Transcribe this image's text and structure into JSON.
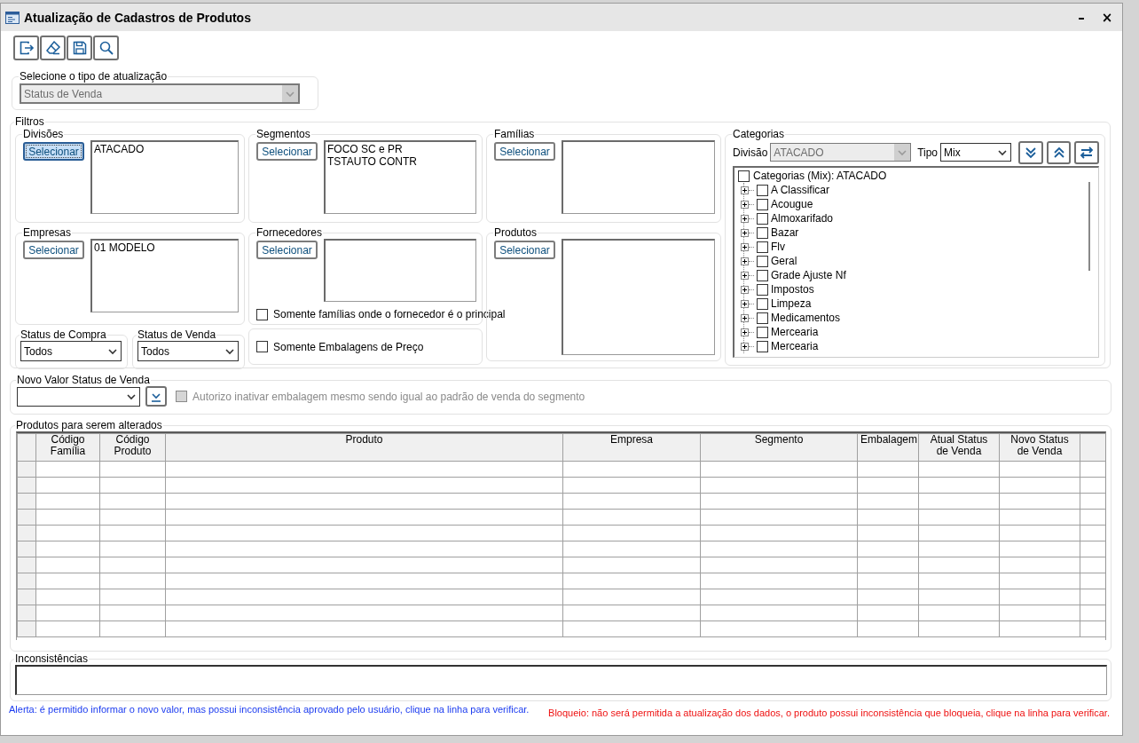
{
  "window": {
    "title": "Atualização de Cadastros de Produtos",
    "minimize": "–",
    "close": "×"
  },
  "toolbar": [
    {
      "kind": "exit"
    },
    {
      "kind": "clear"
    },
    {
      "kind": "save"
    },
    {
      "kind": "search"
    }
  ],
  "update_type": {
    "label": "Selecione o tipo de atualização",
    "value": "Status de Venda",
    "disabled": true
  },
  "filters": {
    "title": "Filtros",
    "divisions": {
      "title": "Divisões",
      "button": "Selecionar",
      "focused": true,
      "items": [
        "ATACADO"
      ]
    },
    "companies": {
      "title": "Empresas",
      "button": "Selecionar",
      "focused": false,
      "items": [
        "01 MODELO"
      ]
    },
    "purchase_status": {
      "title": "Status de Compra",
      "value": "Todos"
    },
    "sale_status": {
      "title": "Status de Venda",
      "value": "Todos"
    },
    "segments": {
      "title": "Segmentos",
      "button": "Selecionar",
      "focused": false,
      "items": [
        "FOCO SC e PR",
        "TSTAUTO CONTR"
      ]
    },
    "suppliers": {
      "title": "Fornecedores",
      "button": "Selecionar",
      "focused": false
    },
    "main_supplier_only": {
      "label": "Somente famílias onde o fornecedor é o principal",
      "checked": false
    },
    "price_packs_only": {
      "label": "Somente Embalagens de Preço",
      "checked": false
    },
    "families": {
      "title": "Famílias",
      "button": "Selecionar",
      "focused": false
    },
    "products": {
      "title": "Produtos",
      "button": "Selecionar",
      "focused": false
    },
    "categories": {
      "title": "Categorias",
      "division_label": "Divisão",
      "division": "ATACADO",
      "division_disabled": true,
      "type_label": "Tipo",
      "type": "Mix",
      "buttons": [
        {
          "kind": "expand_all"
        },
        {
          "kind": "collapse_all"
        },
        {
          "kind": "swap"
        }
      ],
      "tree": {
        "label": "Categorias (Mix): ATACADO",
        "checked": false,
        "children": [
          {
            "label": "A Classificar",
            "checked": false,
            "expanded": false
          },
          {
            "label": "Acougue",
            "checked": false,
            "expanded": false
          },
          {
            "label": "Almoxarifado",
            "checked": false,
            "expanded": false
          },
          {
            "label": "Bazar",
            "checked": false,
            "expanded": false
          },
          {
            "label": "Flv",
            "checked": false,
            "expanded": false
          },
          {
            "label": "Geral",
            "checked": false,
            "expanded": false
          },
          {
            "label": "Grade Ajuste Nf",
            "checked": false,
            "expanded": false
          },
          {
            "label": "Impostos",
            "checked": false,
            "expanded": false
          },
          {
            "label": "Limpeza",
            "checked": false,
            "expanded": false
          },
          {
            "label": "Medicamentos",
            "checked": false,
            "expanded": false
          },
          {
            "label": "Mercearia",
            "checked": false,
            "expanded": false
          },
          {
            "label": "Mercearia",
            "checked": false,
            "expanded": false
          }
        ]
      }
    }
  },
  "new_value": {
    "title": "Novo Valor Status de Venda",
    "authorize": {
      "label": "Autorizo inativar embalagem mesmo sendo igual ao padrão de venda do segmento",
      "checked": false,
      "disabled": true
    }
  },
  "products_grid": {
    "title": "Produtos para serem alterados",
    "columns": [
      "Código\nFamília",
      "Código\nProduto",
      "Produto",
      "Empresa",
      "Segmento",
      "Embalagem",
      "Atual Status\nde Venda",
      "Novo Status\nde Venda"
    ]
  },
  "inconsistencies": {
    "title": "Inconsistências"
  },
  "legend": [
    {
      "kind": "alert",
      "text": "Alerta: é permitido informar o novo valor, mas possui inconsistência aprovado pelo usuário, clique na linha para verificar."
    },
    {
      "kind": "block",
      "text": "Bloqueio: não será permitida a atualização dos dados, o produto possui inconsistência que bloqueia, clique na linha para verificar."
    }
  ]
}
